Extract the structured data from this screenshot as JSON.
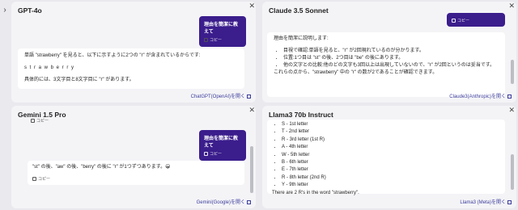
{
  "expand_icon": "chevron-right-icon",
  "panels": {
    "gpt": {
      "title": "GPT-4o",
      "user_msg": "理由を簡潔に教えて",
      "copy": "コピー",
      "answer_line1": "単語 \"strawberry\" を見ると、以下に示すように2つの \"r\" が含まれているからです:",
      "answer_line2": "s t r a w b e r r y",
      "answer_line3": "具体的には、3文字目と8文字目に \"r\" があります。",
      "link": "ChatGPT(OpenAI)を開く"
    },
    "claude": {
      "title": "Claude 3.5 Sonnet",
      "copy": "コピー",
      "intro": "理由を簡潔に説明します:",
      "bullets": [
        "目視で確認:単語を見ると、\"r\" が2回現れているのが分かります。",
        "位置:1つ目は \"st\" の後、2つ目は \"be\" の後にあります。",
        "他の文字との比較:他のどの文字も3回以上は出現していないので、\"r\" が2回というのは妥当です。"
      ],
      "conclusion": "これらの点から、\"strawberry\" 中の \"r\" の数が2であることが確認できます。",
      "link": "Claude3(Anthropic)を開く"
    },
    "gemini": {
      "title": "Gemini 1.5 Pro",
      "copy_top": "コピー",
      "user_msg": "理由を簡潔に教えて",
      "copy": "コピー",
      "answer": "\"st\" の後、\"aw\" の後、\"berry\" の後に \"r\" が1つずつあります。😀",
      "copy_bottom": "コピー",
      "link": "Gemini(Google)を開く"
    },
    "llama": {
      "title": "Llama3 70b Instruct",
      "letters": [
        "S - 1st letter",
        "T - 2nd letter",
        "R - 3rd letter (1st R)",
        "A - 4th letter",
        "W - 5th letter",
        "B - 6th letter",
        "E - 7th letter",
        "R - 8th letter (2nd R)",
        "Y - 9th letter"
      ],
      "conclusion": "There are 2 R's in the word \"strawberry\".",
      "link": "Llama3 (Meta)を開く"
    }
  }
}
